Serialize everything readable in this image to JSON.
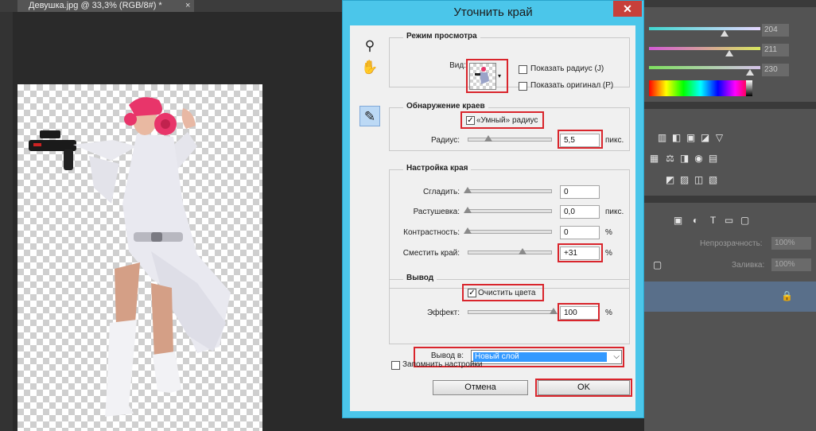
{
  "document": {
    "tab_label": "Девушка.jpg @ 33,3% (RGB/8#) *",
    "close_glyph": "×"
  },
  "right_panel": {
    "values": [
      "204",
      "211",
      "230"
    ],
    "opacity_label": "Непрозрачность:",
    "opacity_value": "100%",
    "fill_label": "Заливка:",
    "fill_value": "100%"
  },
  "dialog": {
    "title": "Уточнить край",
    "close_glyph": "✕",
    "view_mode": {
      "title": "Режим просмотра",
      "view_label": "Вид:",
      "show_radius": "Показать радиус (J)",
      "show_original": "Показать оригинал (P)"
    },
    "edge_detection": {
      "title": "Обнаружение краев",
      "smart_radius": "«Умный» радиус",
      "smart_radius_checked": true,
      "radius_label": "Радиус:",
      "radius_value": "5,5",
      "radius_unit": "пикс.",
      "radius_level": 0.15
    },
    "adjust_edge": {
      "title": "Настройка края",
      "smooth_label": "Сгладить:",
      "smooth_value": "0",
      "feather_label": "Растушевка:",
      "feather_value": "0,0",
      "feather_unit": "пикс.",
      "contrast_label": "Контрастность:",
      "contrast_value": "0",
      "contrast_unit": "%",
      "shift_label": "Сместить край:",
      "shift_value": "+31",
      "shift_unit": "%"
    },
    "output": {
      "title": "Вывод",
      "decontaminate": "Очистить цвета",
      "decontaminate_checked": true,
      "effect_label": "Эффект:",
      "effect_value": "100",
      "effect_unit": "%",
      "output_to_label": "Вывод в:",
      "output_to_value": "Новый слой"
    },
    "remember": "Запомнить настройки",
    "cancel": "Отмена",
    "ok": "OK"
  }
}
